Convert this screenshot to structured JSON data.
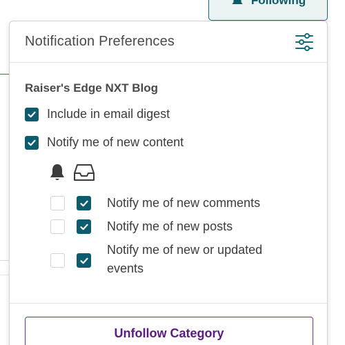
{
  "following_button": {
    "label": "Following",
    "icon": "bell-icon"
  },
  "panel": {
    "title": "Notification Preferences",
    "settings_icon": "sliders-icon",
    "category_name": "Raiser's Edge NXT Blog",
    "options": [
      {
        "label": "Include in email digest",
        "checked": true
      },
      {
        "label": "Notify me of new content",
        "checked": true
      }
    ],
    "channel_icons": [
      "bell-icon",
      "inbox-icon"
    ],
    "sub_options": [
      {
        "label": "Notify me of new comments",
        "bell_checked": false,
        "inbox_checked": true
      },
      {
        "label": "Notify me of new posts",
        "bell_checked": false,
        "inbox_checked": true
      },
      {
        "label": "Notify me of new or updated events",
        "bell_checked": false,
        "inbox_checked": true
      }
    ],
    "unfollow_label": "Unfollow Category"
  },
  "colors": {
    "accent_teal": "#0b5c6e",
    "unfollow_purple": "#5b1a86"
  }
}
